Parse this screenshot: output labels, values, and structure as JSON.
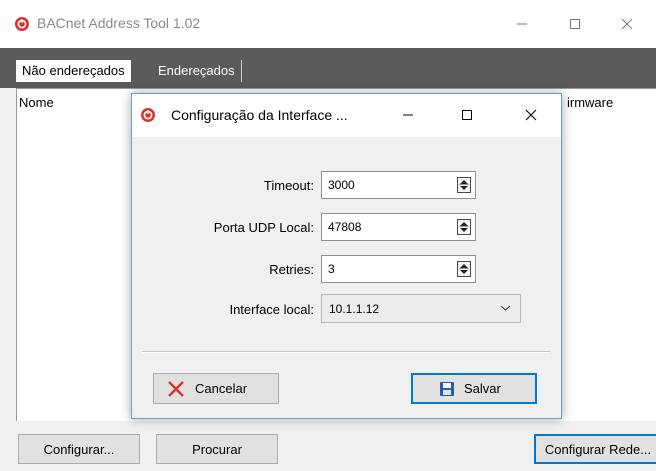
{
  "main_window": {
    "title": "BACnet Address Tool 1.02",
    "tabs": [
      {
        "label": "Não endereçados",
        "active": true
      },
      {
        "label": "Endereçados",
        "active": false
      }
    ],
    "columns": {
      "nome": "Nome",
      "firmware": "irmware"
    },
    "buttons": {
      "configurar": "Configurar...",
      "procurar": "Procurar",
      "configurar_rede": "Configurar Rede..."
    }
  },
  "dialog": {
    "title": "Configuração da Interface ...",
    "fields": {
      "timeout": {
        "label": "Timeout:",
        "value": "3000"
      },
      "porta_udp": {
        "label": "Porta UDP Local:",
        "value": "47808"
      },
      "retries": {
        "label": "Retries:",
        "value": "3"
      },
      "interface": {
        "label": "Interface local:",
        "value": "10.1.1.12"
      }
    },
    "buttons": {
      "cancelar": "Cancelar",
      "salvar": "Salvar"
    }
  },
  "colors": {
    "accent_blue": "#0078d7",
    "icon_red": "#d9352b",
    "tab_bar": "#5a5a5a"
  }
}
